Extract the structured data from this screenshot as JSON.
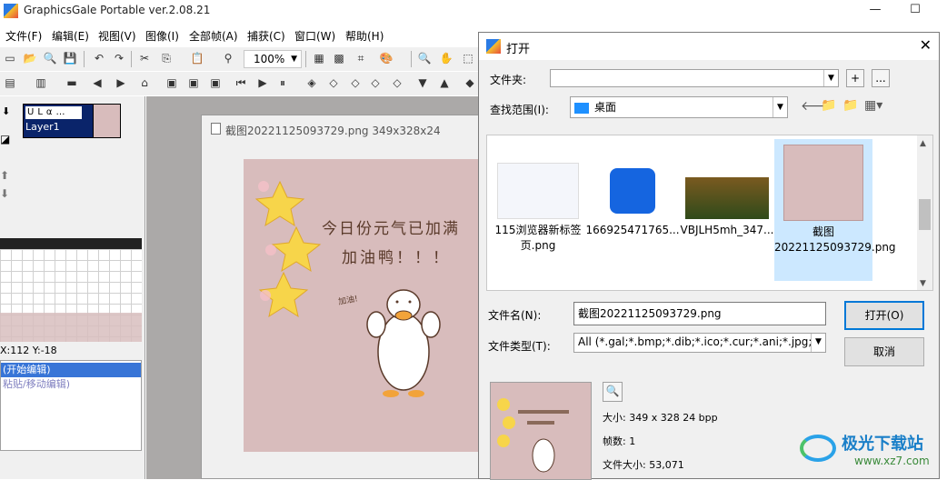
{
  "app": {
    "title": "GraphicsGale Portable ver.2.08.21",
    "window_controls": [
      "—",
      "☐"
    ]
  },
  "menu": [
    "文件(F)",
    "编辑(E)",
    "视图(V)",
    "图像(I)",
    "全部帧(A)",
    "捕获(C)",
    "窗口(W)",
    "帮助(H)"
  ],
  "toolbar": {
    "zoom": "100%"
  },
  "layers": {
    "layer_name": "Layer1",
    "flags": "ULα…"
  },
  "status": {
    "coords": "X:112 Y:-18"
  },
  "history": [
    "(开始编辑)",
    "粘贴/移动编辑)"
  ],
  "document": {
    "title": "截图20221125093729.png 349x328x24",
    "image_text_line1": "今日份元气已加满",
    "image_text_line2": "加油鸭！！！",
    "image_text_small": "加油!"
  },
  "dialog": {
    "title": "打开",
    "folder_label": "文件夹:",
    "folder_value": "",
    "folder_btn_plus": "+",
    "folder_btn_more": "...",
    "lookin_label": "查找范围(I):",
    "lookin_value": "桌面",
    "files": [
      {
        "name": "115浏览器新标签页.png"
      },
      {
        "name": "166925471765..."
      },
      {
        "name": "VBJLH5mh_347..."
      },
      {
        "name": "截图20221125093729.png",
        "selected": true
      }
    ],
    "filename_label": "文件名(N):",
    "filename_value": "截图20221125093729.png",
    "filetype_label": "文件类型(T):",
    "filetype_value": "All (*.gal;*.bmp;*.dib;*.ico;*.cur;*.ani;*.jpg;*.jpe",
    "open_button": "打开(O)",
    "cancel_button": "取消",
    "info_size": "大小: 349 x 328  24 bpp",
    "info_frames": "帧数: 1",
    "info_filesize": "文件大小: 53,071"
  },
  "watermark": {
    "text": "极光下载站",
    "url": "www.xz7.com"
  },
  "colors": {
    "selection": "#3875d7",
    "dialog_bg": "#f0f0f0",
    "canvas_pink": "#d8bcbc",
    "default_button_border": "#0078d7"
  }
}
